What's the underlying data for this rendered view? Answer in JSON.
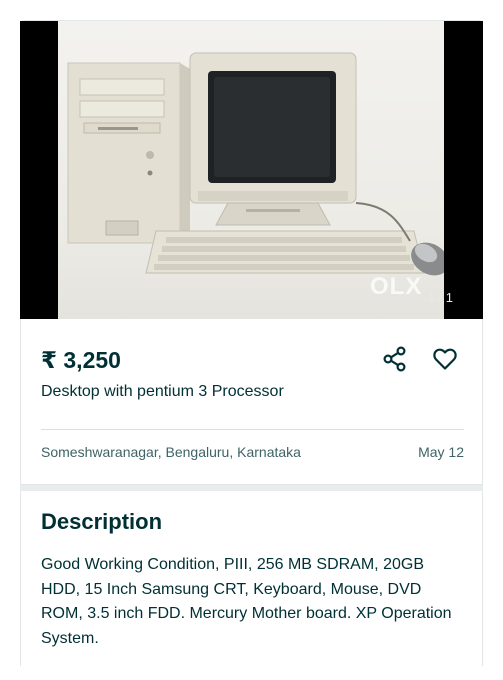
{
  "listing": {
    "image_counter": "1 / 1",
    "watermark": "OLX",
    "price": "₹ 3,250",
    "title": "Desktop with pentium 3 Processor",
    "location": "Someshwaranagar, Bengaluru, Karnataka",
    "date": "May 12"
  },
  "description": {
    "heading": "Description",
    "text": "Good Working Condition, PIII, 256 MB SDRAM, 20GB HDD, 15 Inch Samsung CRT, Keyboard, Mouse, DVD ROM, 3.5 inch FDD. Mercury Mother board. XP Operation System."
  },
  "icons": {
    "share": "share-icon",
    "favorite": "heart-icon"
  },
  "colors": {
    "text_primary": "#002f34",
    "text_secondary": "#406367",
    "gallery_background": "#000000"
  }
}
